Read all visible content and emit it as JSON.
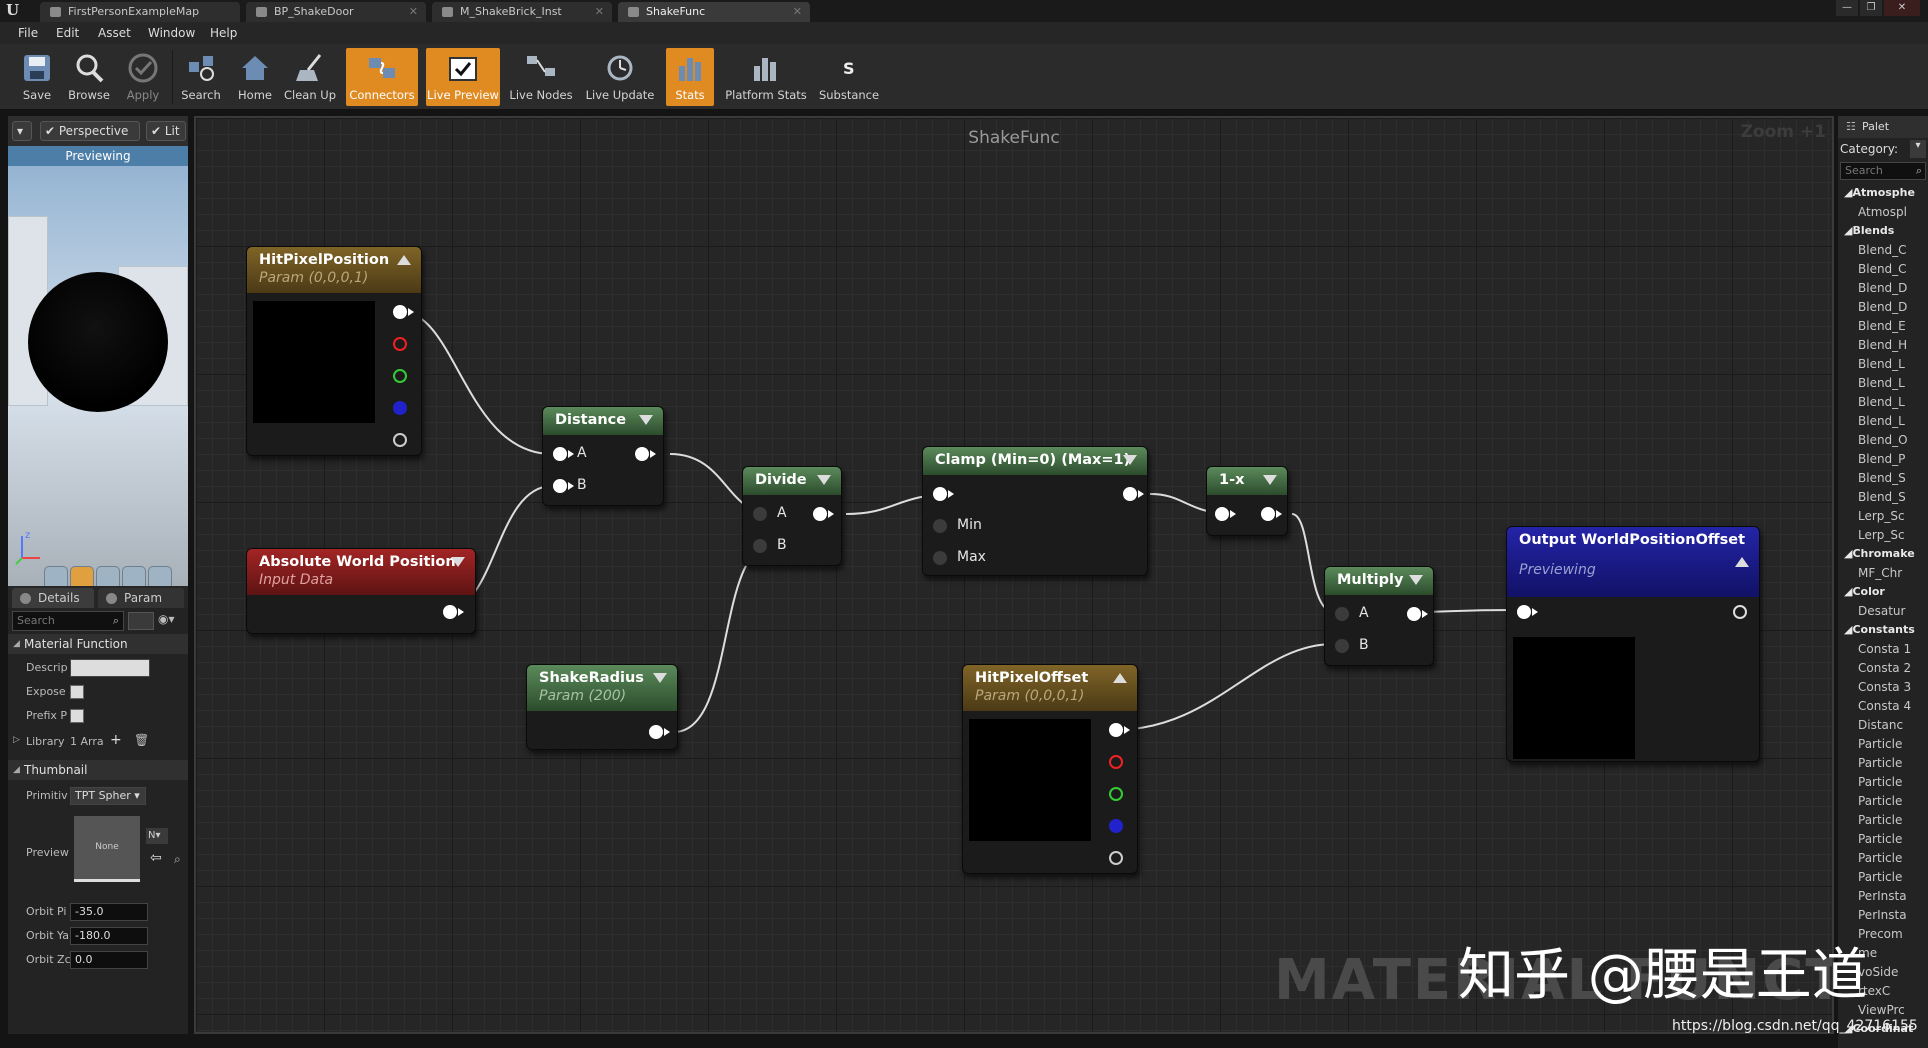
{
  "tabs": [
    {
      "label": "FirstPersonExampleMap"
    },
    {
      "label": "BP_ShakeDoor"
    },
    {
      "label": "M_ShakeBrick_Inst"
    },
    {
      "label": "ShakeFunc"
    }
  ],
  "menu": [
    "File",
    "Edit",
    "Asset",
    "Window",
    "Help"
  ],
  "toolbar": [
    {
      "label": "Save",
      "icon": "save-icon",
      "active": false
    },
    {
      "label": "Browse",
      "icon": "browse-icon",
      "active": false
    },
    {
      "label": "Apply",
      "icon": "apply-icon",
      "active": false
    },
    {
      "label": "Search",
      "icon": "search-icon",
      "active": false
    },
    {
      "label": "Home",
      "icon": "home-icon",
      "active": false
    },
    {
      "label": "Clean Up",
      "icon": "cleanup-icon",
      "active": false
    },
    {
      "label": "Connectors",
      "icon": "connectors-icon",
      "active": true
    },
    {
      "label": "Live Preview",
      "icon": "live-preview-icon",
      "active": true
    },
    {
      "label": "Live Nodes",
      "icon": "live-nodes-icon",
      "active": false
    },
    {
      "label": "Live Update",
      "icon": "live-update-icon",
      "active": false
    },
    {
      "label": "Stats",
      "icon": "stats-icon",
      "active": true
    },
    {
      "label": "Platform Stats",
      "icon": "platform-stats-icon",
      "active": false
    },
    {
      "label": "Substance",
      "icon": "substance-icon",
      "active": false
    }
  ],
  "viewport": {
    "perspective": "Perspective",
    "lit": "Lit",
    "status": "Previewing"
  },
  "details": {
    "tab_details": "Details",
    "tab_param": "Param",
    "search_placeholder": "Search",
    "section_material_function": "Material Function",
    "descrip_label": "Descrip",
    "expose_label": "Expose",
    "prefix_label": "Prefix P",
    "library_label": "Library",
    "library_value": "1 Arra",
    "section_thumbnail": "Thumbnail",
    "primitive_label": "Primitiv",
    "primitive_value": "TPT Spher",
    "preview_label": "Preview",
    "preview_none": "None",
    "preview_btn": "N",
    "orbit_pitch_label": "Orbit Pi",
    "orbit_pitch_value": "-35.0",
    "orbit_yaw_label": "Orbit Ya",
    "orbit_yaw_value": "-180.0",
    "orbit_zoom_label": "Orbit Zc",
    "orbit_zoom_value": "0.0"
  },
  "graph": {
    "title": "ShakeFunc",
    "zoom": "Zoom +1",
    "watermark": "MATERIAL FUNCTION",
    "nodes": {
      "hitpixelposition": {
        "title": "HitPixelPosition",
        "subtitle": "Param (0,0,0,1)"
      },
      "absoluteworldposition": {
        "title": "Absolute World Position",
        "subtitle": "Input Data"
      },
      "distance": {
        "title": "Distance",
        "pin_a": "A",
        "pin_b": "B"
      },
      "shakeradius": {
        "title": "ShakeRadius",
        "subtitle": "Param (200)"
      },
      "divide": {
        "title": "Divide",
        "pin_a": "A",
        "pin_b": "B"
      },
      "clamp": {
        "title": "Clamp (Min=0) (Max=1)",
        "pin_min": "Min",
        "pin_max": "Max"
      },
      "oneminus": {
        "title": "1-x"
      },
      "hitpixeloffset": {
        "title": "HitPixelOffset",
        "subtitle": "Param (0,0,0,1)"
      },
      "multiply": {
        "title": "Multiply",
        "pin_a": "A",
        "pin_b": "B"
      },
      "output": {
        "title": "Output WorldPositionOffset",
        "subtitle": "Previewing"
      }
    }
  },
  "palette": {
    "title": "Palet",
    "category_label": "Category:",
    "search_placeholder": "Search",
    "items": [
      {
        "kind": "cat",
        "text": "Atmosphe"
      },
      {
        "kind": "item",
        "text": "Atmospl"
      },
      {
        "kind": "cat",
        "text": "Blends"
      },
      {
        "kind": "item",
        "text": "Blend_C"
      },
      {
        "kind": "item",
        "text": "Blend_C"
      },
      {
        "kind": "item",
        "text": "Blend_D"
      },
      {
        "kind": "item",
        "text": "Blend_D"
      },
      {
        "kind": "item",
        "text": "Blend_E"
      },
      {
        "kind": "item",
        "text": "Blend_H"
      },
      {
        "kind": "item",
        "text": "Blend_L"
      },
      {
        "kind": "item",
        "text": "Blend_L"
      },
      {
        "kind": "item",
        "text": "Blend_L"
      },
      {
        "kind": "item",
        "text": "Blend_L"
      },
      {
        "kind": "item",
        "text": "Blend_O"
      },
      {
        "kind": "item",
        "text": "Blend_P"
      },
      {
        "kind": "item",
        "text": "Blend_S"
      },
      {
        "kind": "item",
        "text": "Blend_S"
      },
      {
        "kind": "item",
        "text": "Lerp_Sc"
      },
      {
        "kind": "item",
        "text": "Lerp_Sc"
      },
      {
        "kind": "cat",
        "text": "Chromake"
      },
      {
        "kind": "item",
        "text": "MF_Chr"
      },
      {
        "kind": "cat",
        "text": "Color"
      },
      {
        "kind": "item",
        "text": "Desatur"
      },
      {
        "kind": "cat",
        "text": "Constants"
      },
      {
        "kind": "item",
        "text": "Consta 1"
      },
      {
        "kind": "item",
        "text": "Consta 2"
      },
      {
        "kind": "item",
        "text": "Consta 3"
      },
      {
        "kind": "item",
        "text": "Consta 4"
      },
      {
        "kind": "item",
        "text": "Distanc"
      },
      {
        "kind": "item",
        "text": "Particle"
      },
      {
        "kind": "item",
        "text": "Particle"
      },
      {
        "kind": "item",
        "text": "Particle"
      },
      {
        "kind": "item",
        "text": "Particle"
      },
      {
        "kind": "item",
        "text": "Particle"
      },
      {
        "kind": "item",
        "text": "Particle"
      },
      {
        "kind": "item",
        "text": "Particle"
      },
      {
        "kind": "item",
        "text": "Particle"
      },
      {
        "kind": "item",
        "text": "PerInsta"
      },
      {
        "kind": "item",
        "text": "PerInsta"
      },
      {
        "kind": "item",
        "text": "Precom"
      },
      {
        "kind": "item",
        "text": "me"
      },
      {
        "kind": "item",
        "text": "voSide"
      },
      {
        "kind": "item",
        "text": "rtexC"
      },
      {
        "kind": "item",
        "text": "ViewPrc"
      },
      {
        "kind": "cat",
        "text": "Coordinat"
      }
    ]
  },
  "overlay": {
    "zhihu": "知乎 @腰是王道",
    "url": "https://blog.csdn.net/qq_42716155"
  },
  "colors": {
    "active_toolbar": "#e08a22",
    "param_header": "#806427",
    "green_header": "#5b8a5b",
    "red_header": "#a32525",
    "output_header": "#2424a8",
    "viewport_status": "#4d7ea8"
  }
}
